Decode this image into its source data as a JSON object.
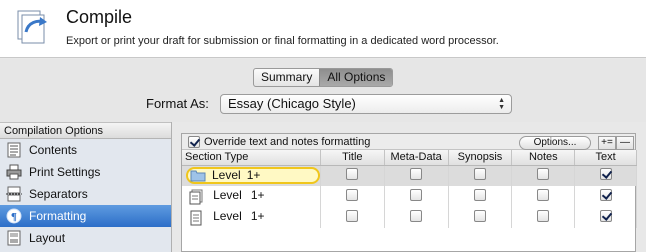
{
  "header": {
    "title": "Compile",
    "subtitle": "Export or print your draft for submission or final formatting in a dedicated word processor."
  },
  "view_toggle": {
    "summary": "Summary",
    "all_options": "All Options",
    "selected": "All Options"
  },
  "format": {
    "label": "Format As:",
    "value": "Essay (Chicago Style)"
  },
  "sidebar": {
    "header": "Compilation Options",
    "items": [
      {
        "label": "Contents",
        "icon": "contents-list-icon"
      },
      {
        "label": "Print Settings",
        "icon": "printer-icon"
      },
      {
        "label": "Separators",
        "icon": "separators-icon"
      },
      {
        "label": "Formatting",
        "icon": "formatting-icon",
        "selected": true
      },
      {
        "label": "Layout",
        "icon": "layout-icon"
      }
    ]
  },
  "panel": {
    "override_label": "Override text and notes formatting",
    "override_checked": true,
    "options_button": "Options...",
    "add_button": "+=",
    "remove_button": "—",
    "columns": [
      "Section Type",
      "Title",
      "Meta-Data",
      "Synopsis",
      "Notes",
      "Text"
    ],
    "rows": [
      {
        "level": "Level",
        "depth": "1+",
        "icon": "folder-icon",
        "selected": true,
        "title": false,
        "meta": false,
        "synopsis": false,
        "notes": false,
        "text": true
      },
      {
        "level": "Level",
        "depth": "1+",
        "icon": "document-stack-icon",
        "selected": false,
        "title": false,
        "meta": false,
        "synopsis": false,
        "notes": false,
        "text": true
      },
      {
        "level": "Level",
        "depth": "1+",
        "icon": "document-icon",
        "selected": false,
        "title": false,
        "meta": false,
        "synopsis": false,
        "notes": false,
        "text": true
      }
    ]
  },
  "colors": {
    "selection_blue": "#2c6ec8",
    "edit_highlight": "#f0c61c"
  }
}
